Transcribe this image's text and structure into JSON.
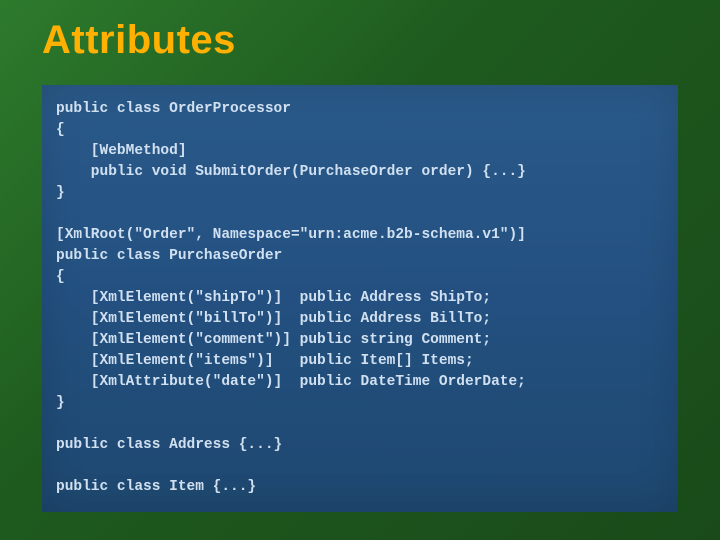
{
  "slide": {
    "title": "Attributes",
    "code": "public class OrderProcessor\n{\n    [WebMethod]\n    public void SubmitOrder(PurchaseOrder order) {...}\n}\n\n[XmlRoot(\"Order\", Namespace=\"urn:acme.b2b-schema.v1\")]\npublic class PurchaseOrder\n{\n    [XmlElement(\"shipTo\")]  public Address ShipTo;\n    [XmlElement(\"billTo\")]  public Address BillTo;\n    [XmlElement(\"comment\")] public string Comment;\n    [XmlElement(\"items\")]   public Item[] Items;\n    [XmlAttribute(\"date\")]  public DateTime OrderDate;\n}\n\npublic class Address {...}\n\npublic class Item {...}"
  }
}
